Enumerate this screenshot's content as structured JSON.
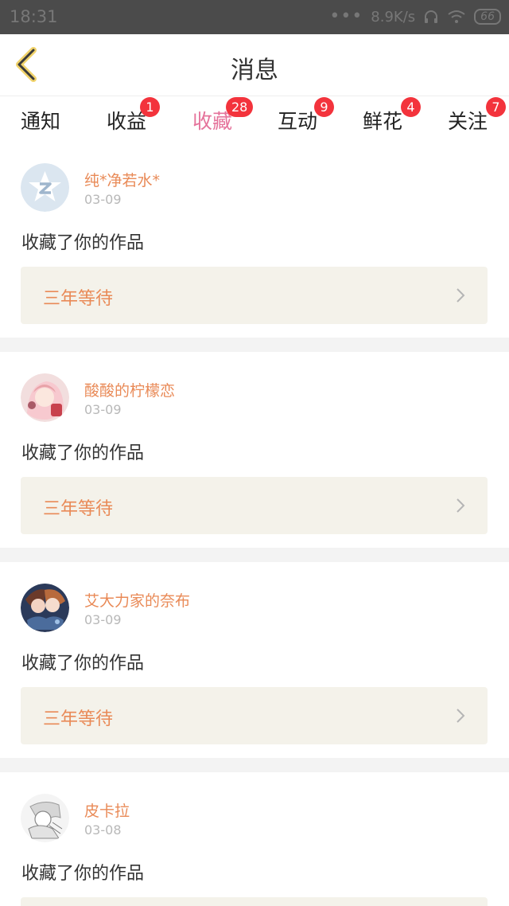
{
  "status_bar": {
    "time": "18:31",
    "network_speed": "8.9K/s",
    "battery": "66"
  },
  "header": {
    "title": "消息"
  },
  "tabs": [
    {
      "label": "通知",
      "badge": ""
    },
    {
      "label": "收益",
      "badge": "1"
    },
    {
      "label": "收藏",
      "badge": "28"
    },
    {
      "label": "互动",
      "badge": "9"
    },
    {
      "label": "鲜花",
      "badge": "4"
    },
    {
      "label": "关注",
      "badge": "7"
    }
  ],
  "active_tab": "收藏",
  "items": [
    {
      "name": "纯*净若水*",
      "date": "03-09",
      "message": "收藏了你的作品",
      "work_title": "三年等待",
      "avatar": "qq-avatar-icon"
    },
    {
      "name": "酸酸的柠檬恋",
      "date": "03-09",
      "message": "收藏了你的作品",
      "work_title": "三年等待",
      "avatar": "anime-girl-avatar"
    },
    {
      "name": "艾大力家的奈布",
      "date": "03-09",
      "message": "收藏了你的作品",
      "work_title": "三年等待",
      "avatar": "anime-couple-avatar"
    },
    {
      "name": "皮卡拉",
      "date": "03-08",
      "message": "收藏了你的作品",
      "work_title": "",
      "avatar": "sketch-avatar"
    }
  ],
  "colors": {
    "accent_pink": "#e5739b",
    "name_orange": "#e98a57",
    "badge_red": "#f3333c",
    "work_bg": "#f4f2ea",
    "back_arrow": "#f1d36b"
  }
}
